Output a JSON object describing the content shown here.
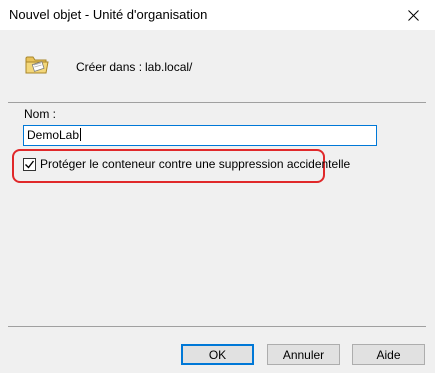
{
  "window": {
    "title": "Nouvel objet - Unité d'organisation"
  },
  "create_in": {
    "label": "Créer dans :",
    "value": "lab.local/"
  },
  "name_field": {
    "label": "Nom :",
    "value": "DemoLab"
  },
  "protect_checkbox": {
    "label": "Protéger le conteneur contre une suppression accidentelle",
    "checked": true
  },
  "buttons": {
    "ok": "OK",
    "cancel": "Annuler",
    "help": "Aide"
  },
  "icons": {
    "close": "close-icon",
    "folder": "folder-ou-icon",
    "check": "check-icon"
  },
  "colors": {
    "accent": "#0078d7",
    "highlight": "#e0282a",
    "dialog_bg": "#f0f0f0"
  }
}
